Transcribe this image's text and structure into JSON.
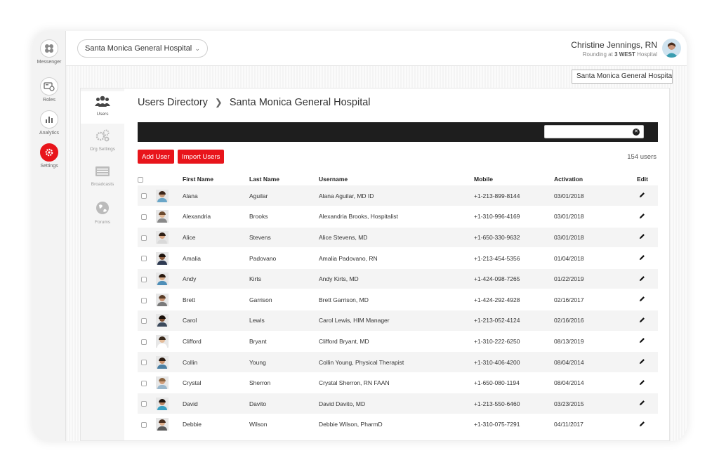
{
  "rail": [
    {
      "name": "messenger",
      "label": "Messenger",
      "icon": "messenger-icon"
    },
    {
      "name": "roles",
      "label": "Roles",
      "icon": "roles-icon"
    },
    {
      "name": "analytics",
      "label": "Analytics",
      "icon": "analytics-icon"
    },
    {
      "name": "settings",
      "label": "Settings",
      "icon": "gear-icon",
      "active": true
    }
  ],
  "header": {
    "org_select": "Santa Monica General Hospital",
    "user_name": "Christine Jennings, RN",
    "rounding_prefix": "Rounding at",
    "rounding_unit": "3 WEST",
    "rounding_suffix": "Hospital"
  },
  "hospital_box": "Santa Monica General Hospital",
  "subnav": [
    {
      "label": "Users",
      "icon": "users-icon",
      "active": true
    },
    {
      "label": "Org Settings",
      "icon": "gears-icon"
    },
    {
      "label": "Broadcasts",
      "icon": "broadcast-icon"
    },
    {
      "label": "Forums",
      "icon": "globe-icon"
    }
  ],
  "breadcrumb": {
    "root": "Users Directory",
    "separator": "❯",
    "current": "Santa Monica General Hospital"
  },
  "search": {
    "value": "",
    "placeholder": ""
  },
  "buttons": {
    "add_user": "Add User",
    "import_users": "Import Users"
  },
  "user_count": "154 users",
  "table": {
    "headers": {
      "first": "First Name",
      "last": "Last Name",
      "username": "Username",
      "mobile": "Mobile",
      "activation": "Activation",
      "edit": "Edit"
    },
    "rows": [
      {
        "first": "Alana",
        "last": "Aguilar",
        "username": "Alana Aguilar, MD ID",
        "mobile": "+1-213-899-8144",
        "activation": "03/01/2018"
      },
      {
        "first": "Alexandria",
        "last": "Brooks",
        "username": "Alexandria Brooks, Hospitalist",
        "mobile": "+1-310-996-4169",
        "activation": "03/01/2018"
      },
      {
        "first": "Alice",
        "last": "Stevens",
        "username": "Alice Stevens, MD",
        "mobile": "+1-650-330-9632",
        "activation": "03/01/2018"
      },
      {
        "first": "Amalia",
        "last": "Padovano",
        "username": "Amalia Padovano, RN",
        "mobile": "+1-213-454-5356",
        "activation": "01/04/2018"
      },
      {
        "first": "Andy",
        "last": "Kirts",
        "username": "Andy Kirts, MD",
        "mobile": "+1-424-098-7265",
        "activation": "01/22/2019"
      },
      {
        "first": "Brett",
        "last": "Garrison",
        "username": "Brett Garrison, MD",
        "mobile": "+1-424-292-4928",
        "activation": "02/16/2017"
      },
      {
        "first": "Carol",
        "last": "Lewis",
        "username": "Carol Lewis, HIM Manager",
        "mobile": "+1-213-052-4124",
        "activation": "02/16/2016"
      },
      {
        "first": "Clifford",
        "last": "Bryant",
        "username": "Clifford Bryant, MD",
        "mobile": "+1-310-222-6250",
        "activation": "08/13/2019"
      },
      {
        "first": "Collin",
        "last": "Young",
        "username": "Collin Young, Physical Therapist",
        "mobile": "+1-310-406-4200",
        "activation": "08/04/2014"
      },
      {
        "first": "Crystal",
        "last": "Sherron",
        "username": "Crystal Sherron, RN FAAN",
        "mobile": "+1-650-080-1194",
        "activation": "08/04/2014"
      },
      {
        "first": "David",
        "last": "Davito",
        "username": "David Davito, MD",
        "mobile": "+1-213-550-6460",
        "activation": "03/23/2015"
      },
      {
        "first": "Debbie",
        "last": "Wilson",
        "username": "Debbie Wilson, PharmD",
        "mobile": "+1-310-075-7291",
        "activation": "04/11/2017"
      }
    ]
  },
  "colors": {
    "accent": "#e8151b",
    "bar": "#1e1e1e"
  }
}
